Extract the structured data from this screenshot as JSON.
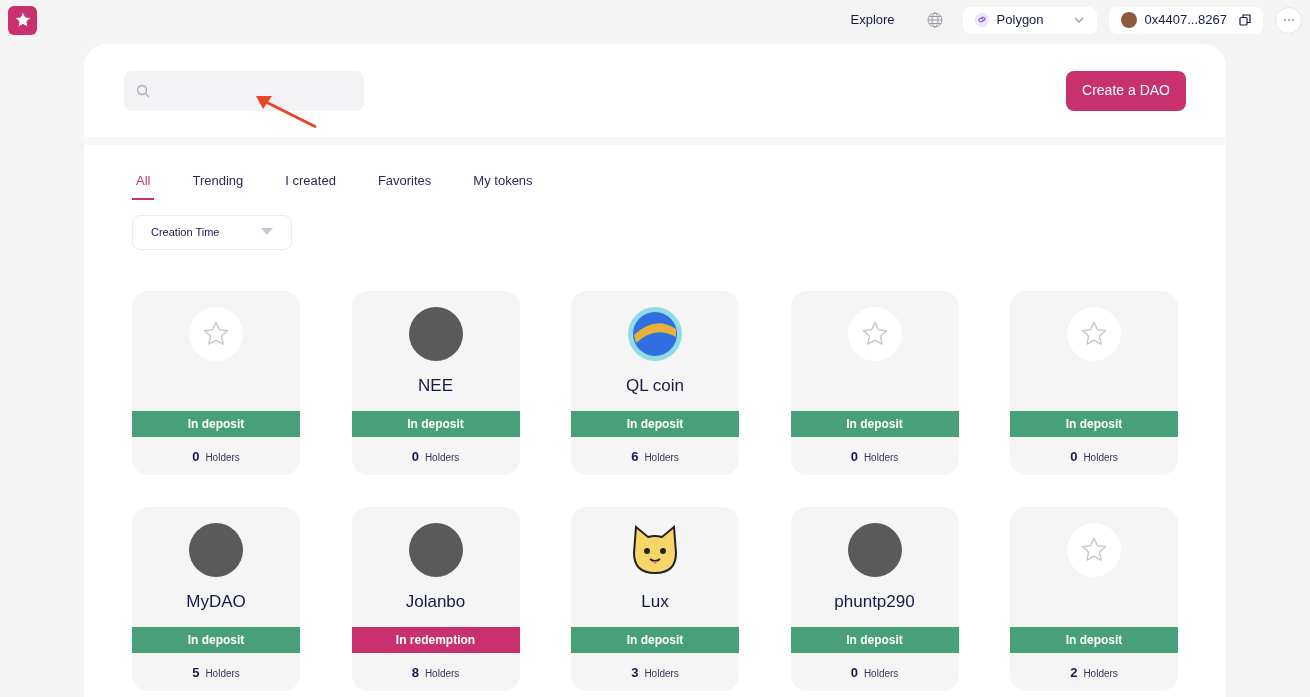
{
  "header": {
    "nav_link": "Explore",
    "network": "Polygon",
    "wallet": "0x4407...8267"
  },
  "create_button": "Create a DAO",
  "tabs": [
    {
      "label": "All",
      "selected": true
    },
    {
      "label": "Trending",
      "selected": false
    },
    {
      "label": "I created",
      "selected": false
    },
    {
      "label": "Favorites",
      "selected": false
    },
    {
      "label": "My tokens",
      "selected": false
    }
  ],
  "sort": {
    "value": "Creation Time"
  },
  "cards": [
    {
      "kind": "placeholder",
      "status": "In deposit",
      "color": "#48a07a",
      "count": "0",
      "count_label": "Holders"
    },
    {
      "kind": "photo",
      "name": "NEE",
      "status": "In deposit",
      "color": "#48a07a",
      "count": "0",
      "count_label": "Holders"
    },
    {
      "kind": "logo",
      "name": "QL coin",
      "status": "In deposit",
      "color": "#48a07a",
      "count": "6",
      "count_label": "Holders"
    },
    {
      "kind": "placeholder",
      "status": "In deposit",
      "color": "#48a07a",
      "count": "0",
      "count_label": "Holders"
    },
    {
      "kind": "placeholder",
      "status": "In deposit",
      "color": "#48a07a",
      "count": "0",
      "count_label": "Holders"
    },
    {
      "kind": "photo",
      "name": "MyDAO",
      "status": "In deposit",
      "color": "#48a07a",
      "count": "5",
      "count_label": "Holders"
    },
    {
      "kind": "photo",
      "name": "Jolanbo",
      "status": "In redemption",
      "color": "#c8306e",
      "count": "8",
      "count_label": "Holders"
    },
    {
      "kind": "cat",
      "name": "Lux",
      "status": "In deposit",
      "color": "#48a07a",
      "count": "3",
      "count_label": "Holders"
    },
    {
      "kind": "photo",
      "name": "phuntp290",
      "status": "In deposit",
      "color": "#48a07a",
      "count": "0",
      "count_label": "Holders"
    },
    {
      "kind": "placeholder",
      "status": "In deposit",
      "color": "#48a07a",
      "count": "2",
      "count_label": "Holders"
    }
  ]
}
